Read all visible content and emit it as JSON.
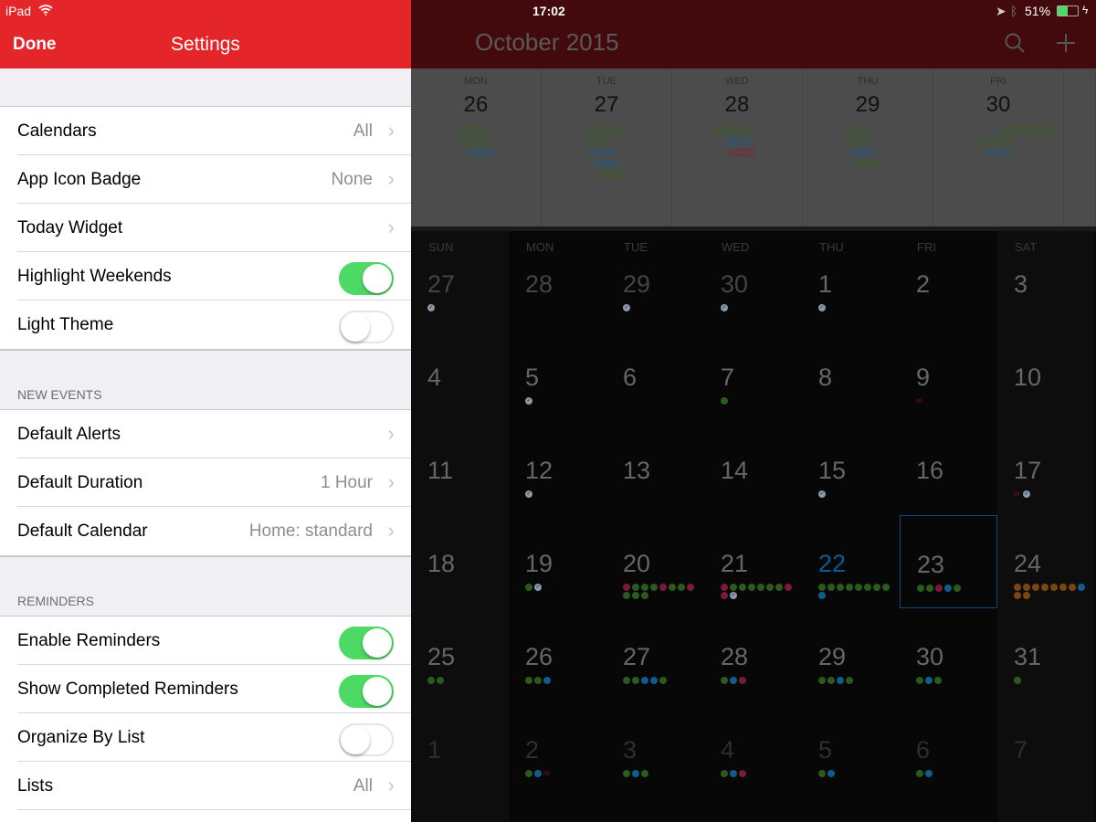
{
  "status": {
    "device": "iPad",
    "time": "17:02",
    "battery": "51%"
  },
  "settings": {
    "done": "Done",
    "title": "Settings",
    "general": [
      {
        "label": "Calendars",
        "value": "All",
        "type": "chevron"
      },
      {
        "label": "App Icon Badge",
        "value": "None",
        "type": "chevron"
      },
      {
        "label": "Today Widget",
        "value": "",
        "type": "chevron"
      },
      {
        "label": "Highlight Weekends",
        "type": "toggle",
        "on": true
      },
      {
        "label": "Light Theme",
        "type": "toggle",
        "on": false
      }
    ],
    "new_events_header": "NEW EVENTS",
    "new_events": [
      {
        "label": "Default Alerts",
        "value": "",
        "type": "chevron"
      },
      {
        "label": "Default Duration",
        "value": "1 Hour",
        "type": "chevron"
      },
      {
        "label": "Default Calendar",
        "value": "Home: standard",
        "type": "chevron"
      }
    ],
    "reminders_header": "REMINDERS",
    "reminders": [
      {
        "label": "Enable Reminders",
        "type": "toggle",
        "on": true
      },
      {
        "label": "Show Completed Reminders",
        "type": "toggle",
        "on": true
      },
      {
        "label": "Organize By List",
        "type": "toggle",
        "on": false
      },
      {
        "label": "Lists",
        "value": "All",
        "type": "chevron"
      },
      {
        "label": "Default List",
        "value": "Si",
        "type": "chevron"
      }
    ]
  },
  "calendar": {
    "month_title": "October 2015",
    "week_strip": [
      {
        "dow": "MON",
        "day": "26",
        "events": [
          [
            "g",
            0,
            0,
            3
          ],
          [
            "g",
            1,
            1,
            4
          ],
          [
            "b",
            2,
            3,
            5
          ]
        ]
      },
      {
        "dow": "TUE",
        "day": "27",
        "events": [
          [
            "g",
            0,
            0,
            4
          ],
          [
            "g",
            1,
            0,
            2
          ],
          [
            "b",
            2,
            1,
            3
          ],
          [
            "b",
            3,
            2,
            4
          ],
          [
            "g",
            4,
            3,
            5
          ]
        ]
      },
      {
        "dow": "WED",
        "day": "28",
        "events": [
          [
            "g",
            0,
            0,
            4
          ],
          [
            "b",
            1,
            2,
            4
          ],
          [
            "r",
            2,
            3,
            5
          ]
        ]
      },
      {
        "dow": "THU",
        "day": "29",
        "events": [
          [
            "g",
            0,
            0,
            2
          ],
          [
            "g",
            1,
            0,
            2
          ],
          [
            "b",
            2,
            1,
            3
          ],
          [
            "g",
            3,
            2,
            4
          ]
        ]
      },
      {
        "dow": "FRI",
        "day": "30",
        "events": [
          [
            "g",
            0,
            5,
            12
          ],
          [
            "g",
            1,
            0,
            4
          ],
          [
            "b",
            2,
            2,
            4
          ]
        ]
      }
    ],
    "weekdays": [
      "SUN",
      "MON",
      "TUE",
      "WED",
      "THU",
      "FRI",
      "SAT"
    ],
    "today": "22",
    "selected": "23",
    "weeks": [
      [
        {
          "d": "27",
          "o": 1,
          "e": "c"
        },
        {
          "d": "28",
          "o": 1,
          "e": ""
        },
        {
          "d": "29",
          "o": 1,
          "e": "c"
        },
        {
          "d": "30",
          "o": 1,
          "e": "c"
        },
        {
          "d": "1",
          "e": "c"
        },
        {
          "d": "2",
          "e": ""
        },
        {
          "d": "3",
          "e": ""
        }
      ],
      [
        {
          "d": "4",
          "e": ""
        },
        {
          "d": "5",
          "e": "c"
        },
        {
          "d": "6",
          "e": ""
        },
        {
          "d": "7",
          "e": "g"
        },
        {
          "d": "8",
          "e": ""
        },
        {
          "d": "9",
          "e": "m"
        },
        {
          "d": "10",
          "e": ""
        }
      ],
      [
        {
          "d": "11",
          "e": ""
        },
        {
          "d": "12",
          "e": "c"
        },
        {
          "d": "13",
          "e": ""
        },
        {
          "d": "14",
          "e": ""
        },
        {
          "d": "15",
          "e": "c"
        },
        {
          "d": "16",
          "e": ""
        },
        {
          "d": "17",
          "e": "mc"
        }
      ],
      [
        {
          "d": "18",
          "e": ""
        },
        {
          "d": "19",
          "e": "gc"
        },
        {
          "d": "20",
          "e": "rgggrggrggg"
        },
        {
          "d": "21",
          "e": "rggggggrrc"
        },
        {
          "d": "22",
          "e": "ggggggggb"
        },
        {
          "d": "23",
          "e": "ggrbg"
        },
        {
          "d": "24",
          "e": "ooooooobo o"
        }
      ],
      [
        {
          "d": "25",
          "e": "gg"
        },
        {
          "d": "26",
          "e": "ggb"
        },
        {
          "d": "27",
          "e": "ggbbg"
        },
        {
          "d": "28",
          "e": "gbr"
        },
        {
          "d": "29",
          "e": "ggbg"
        },
        {
          "d": "30",
          "e": "gbg"
        },
        {
          "d": "31",
          "e": "g"
        }
      ],
      [
        {
          "d": "1",
          "o": 2,
          "e": ""
        },
        {
          "d": "2",
          "o": 2,
          "e": "gbm"
        },
        {
          "d": "3",
          "o": 2,
          "e": "gbg"
        },
        {
          "d": "4",
          "o": 2,
          "e": "gbr"
        },
        {
          "d": "5",
          "o": 2,
          "e": "gb"
        },
        {
          "d": "6",
          "o": 2,
          "e": "gb"
        },
        {
          "d": "7",
          "o": 2,
          "e": ""
        }
      ]
    ],
    "colors": {
      "g": "#2c5a1c",
      "b": "#0f5c8e",
      "r": "#7c1838",
      "o": "#7a4710",
      "c": "#8a9aa8",
      "m": "#8a1010",
      "today": "#0d5a96",
      "accent": "#e4262a"
    }
  }
}
